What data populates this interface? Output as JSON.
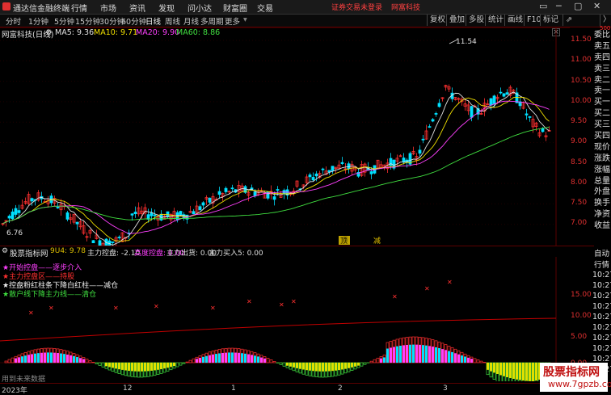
{
  "titlebar": {
    "app_name": "通达信金融终端",
    "menus": [
      "行情",
      "市场",
      "资讯",
      "发现",
      "问小达",
      "财富圈",
      "交易"
    ],
    "alert_login": "证券交易未登录",
    "alert_brand": "网富科技",
    "controls": [
      "▭",
      "─",
      "▢",
      "✕"
    ]
  },
  "toolbar": {
    "periods": [
      "分时",
      "1分钟",
      "5分钟",
      "15分钟",
      "30分钟",
      "60分钟",
      "日线",
      "周线",
      "月线",
      "多周期",
      "更多"
    ],
    "active_period": "日线",
    "right_buttons": [
      "复权",
      "叠加",
      "多股",
      "统计",
      "画线",
      "F10",
      "标记"
    ],
    "share_icon": "share-icon",
    "more": "〉"
  },
  "main_panel": {
    "stock_label": "网富科技(日线)",
    "ma": [
      {
        "label": "MA5: 9.36",
        "color": "#e0e0e0"
      },
      {
        "label": "MA10: 9.71",
        "color": "#f0e000"
      },
      {
        "label": "MA20: 9.90",
        "color": "#ff40ff"
      },
      {
        "label": "MA60: 8.86",
        "color": "#40e040"
      }
    ],
    "y_ticks": [
      "11.50",
      "11.00",
      "10.50",
      "10.00",
      "9.50",
      "9.00",
      "8.50",
      "8.00",
      "7.50",
      "7.00"
    ],
    "high_label": "11.54",
    "low_label": "6.76",
    "signals": [
      "顶",
      "减"
    ],
    "colors": {
      "up": "#ff3030",
      "down": "#00e0ff",
      "ma5": "#e0e0e0",
      "ma10": "#f0e000",
      "ma20": "#ff40ff",
      "ma60": "#40e040"
    }
  },
  "side_order": [
    {
      "label": "委比",
      "color": "#e0e0e0"
    },
    {
      "label": "卖五",
      "color": "#e0e0e0"
    },
    {
      "label": "卖四",
      "color": "#e0e0e0"
    },
    {
      "label": "卖三",
      "color": "#e0e0e0"
    },
    {
      "label": "卖二",
      "color": "#e0e0e0"
    },
    {
      "label": "卖一",
      "color": "#e0e0e0"
    },
    {
      "label": "买一",
      "color": "#e0e0e0"
    },
    {
      "label": "买二",
      "color": "#e0e0e0"
    },
    {
      "label": "买三",
      "color": "#e0e0e0"
    },
    {
      "label": "买四",
      "color": "#e0e0e0"
    },
    {
      "label": "现价",
      "color": "#e0e0e0"
    },
    {
      "label": "涨跌",
      "color": "#e0e0e0"
    },
    {
      "label": "涨幅",
      "color": "#e0e0e0"
    },
    {
      "label": "总量",
      "color": "#e0e0e0"
    },
    {
      "label": "外盘",
      "color": "#e0e0e0"
    },
    {
      "label": "换手",
      "color": "#e0e0e0"
    },
    {
      "label": "净资",
      "color": "#e0e0e0"
    },
    {
      "label": "收益",
      "color": "#e0e0e0"
    }
  ],
  "side_top_label": "500",
  "indicator_panel": {
    "name": "股票指标网",
    "stats": [
      {
        "text": "9U4: 9.78",
        "color": "#e0c000"
      },
      {
        "text": "主力控盘: -2.10",
        "color": "#e0e0e0"
      },
      {
        "text": "高度控盘: 0.00",
        "color": "#ff40ff"
      },
      {
        "text": "主力出货: 0.00",
        "color": "#e0e0e0"
      },
      {
        "text": "主力买入5: 0.00",
        "color": "#e0e0e0"
      }
    ],
    "y_ticks": [
      "15.00",
      "10.00",
      "5.00",
      "0.00"
    ],
    "legend": [
      {
        "text": "★开始控盘——逐步介入",
        "color": "#ff40ff"
      },
      {
        "text": "★主力控盘区——持股",
        "color": "#ff3030"
      },
      {
        "text": "★控盘粉红柱条下降白红柱——减仓",
        "color": "#f0f0f0"
      },
      {
        "text": "★散户线下降主力线——清仓",
        "color": "#40e040"
      }
    ],
    "footer_text": "用到未来数据"
  },
  "side_ticks": {
    "auto": "自动",
    "quote": "行情",
    "times": [
      "10:27",
      "10:27",
      "10:27",
      "10:27",
      "10:27",
      "10:27",
      "10:27",
      "10:27",
      "10:27",
      "10:27"
    ]
  },
  "x_axis": {
    "labels": [
      "2023年",
      "12",
      "1",
      "2",
      "3"
    ]
  },
  "watermark": {
    "line1": "股票指标网",
    "line2": "www.7gpzb.com"
  }
}
